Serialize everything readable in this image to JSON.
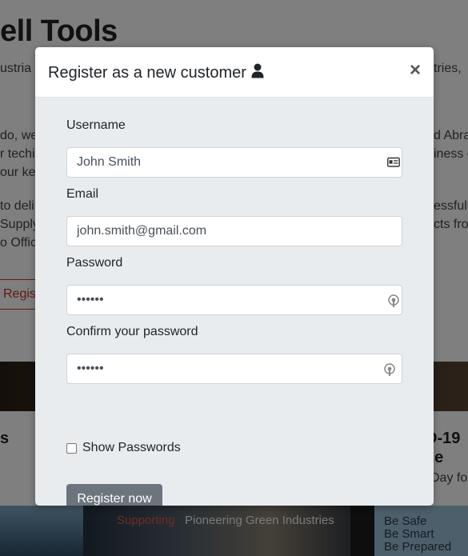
{
  "background": {
    "title_fragment": "ell Tools",
    "text_lines": [
      {
        "left": "ustria",
        "right": "tries,"
      },
      {
        "left": "do, we",
        "right": "d Abra"
      },
      {
        "left": "r techi",
        "right": "iness o"
      },
      {
        "left": "our key",
        "right": ""
      },
      {
        "left": "to deli",
        "right": "essfull"
      },
      {
        "left": "Supply",
        "right": "cts fro"
      },
      {
        "left": "o Offic",
        "right": ""
      }
    ],
    "register_fragment": "Regis",
    "card_left_heading": "s",
    "card_right_heading_1": "D-19",
    "card_right_heading_2": "ce",
    "card_right_sub": "Day fo",
    "banner_highlight": "Supporting",
    "banner_text": "Pioneering Green Industries",
    "be_lines": [
      "Be Safe",
      "Be Smart",
      "Be Prepared"
    ]
  },
  "modal": {
    "title": "Register as a new customer",
    "title_icon": "user-icon",
    "close_label": "×",
    "fields": {
      "username": {
        "label": "Username",
        "value": "John Smith",
        "icon": "id-card-icon"
      },
      "email": {
        "label": "Email",
        "value": "john.smith@gmail.com"
      },
      "password": {
        "label": "Password",
        "value": "••••••",
        "icon": "password-key-icon"
      },
      "confirm": {
        "label": "Confirm your password",
        "value": "••••••",
        "icon": "password-key-icon"
      }
    },
    "show_passwords_label": "Show Passwords",
    "show_passwords_checked": false,
    "submit_label": "Register now"
  }
}
